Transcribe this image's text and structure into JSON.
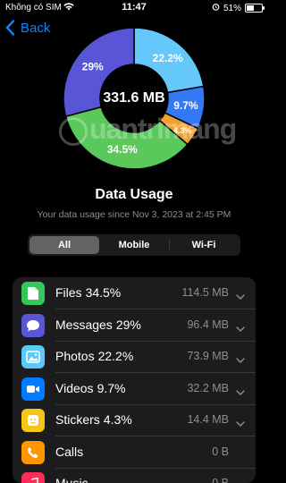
{
  "status_bar": {
    "carrier": "Không có SIM",
    "time": "11:47",
    "battery": "51%",
    "battery_level_fraction": 0.51
  },
  "nav": {
    "back_label": "Back"
  },
  "chart": {
    "center_label": "331.6 MB",
    "watermark": "uantrimang"
  },
  "chart_data": {
    "type": "pie",
    "title": "",
    "slices": [
      {
        "label": "22.2%",
        "value": 22.2,
        "color": "#64c8fa"
      },
      {
        "label": "9.7%",
        "value": 9.7,
        "color": "#3478f6"
      },
      {
        "label": "4.3%",
        "value": 4.3,
        "color": "#f0a030"
      },
      {
        "label": "34.5%",
        "value": 34.5,
        "color": "#5ac85a"
      },
      {
        "label": "29%",
        "value": 29.0,
        "color": "#5856d6"
      }
    ]
  },
  "header": {
    "title": "Data Usage",
    "subtitle": "Your data usage since Nov 3, 2023 at 2:45 PM"
  },
  "segmented": {
    "options": [
      "All",
      "Mobile",
      "Wi-Fi"
    ],
    "selected": "All"
  },
  "list": {
    "items": [
      {
        "name": "Files",
        "percent": "34.5%",
        "size": "114.5 MB",
        "icon": "files-icon",
        "color": "#34c759"
      },
      {
        "name": "Messages",
        "percent": "29%",
        "size": "96.4 MB",
        "icon": "messages-icon",
        "color": "#5856d6"
      },
      {
        "name": "Photos",
        "percent": "22.2%",
        "size": "73.9 MB",
        "icon": "photos-icon",
        "color": "#5ac8fa"
      },
      {
        "name": "Videos",
        "percent": "9.7%",
        "size": "32.2 MB",
        "icon": "videos-icon",
        "color": "#007aff"
      },
      {
        "name": "Stickers",
        "percent": "4.3%",
        "size": "14.4 MB",
        "icon": "stickers-icon",
        "color": "#f5c518"
      },
      {
        "name": "Calls",
        "percent": "",
        "size": "0 B",
        "icon": "calls-icon",
        "color": "#ff9500"
      },
      {
        "name": "Music",
        "percent": "",
        "size": "0 B",
        "icon": "music-icon",
        "color": "#ff2d55"
      }
    ]
  }
}
